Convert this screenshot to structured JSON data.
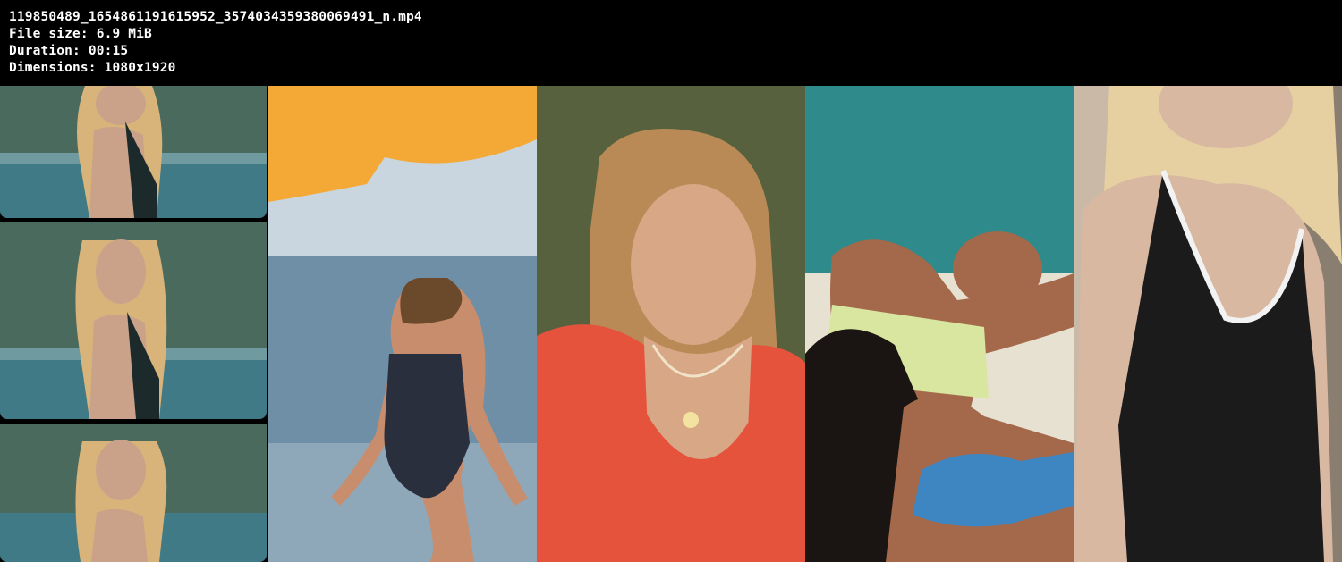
{
  "video_info": {
    "filename": "119850489_1654861191615952_3574034359380069491_n.mp4",
    "file_size_label": "File size:",
    "file_size": "6.9 MiB",
    "duration_label": "Duration:",
    "duration": "00:15",
    "dimensions_label": "Dimensions:",
    "dimensions": "1080x1920"
  },
  "thumbnails": [
    {
      "icon": "triple-film-frame-woman-by-sea-image",
      "colors": {
        "sea": "#3f7a86",
        "rock": "#4b6a5e",
        "hair": "#d8b47a",
        "skin": "#caa28a",
        "suit": "#1d2a2c"
      }
    },
    {
      "icon": "woman-in-gingham-swimsuit-beach-image",
      "colors": {
        "sky": "#c9d6e0",
        "sea": "#6f8fa6",
        "umbrella": "#f4a936",
        "suit": "#2a2f3e",
        "skin": "#c88d6c"
      }
    },
    {
      "icon": "woman-smiling-red-floral-dress-image",
      "colors": {
        "foliage": "#2e4a26",
        "dress": "#e5533d",
        "skin": "#d7a786",
        "hair": "#b98a55"
      }
    },
    {
      "icon": "two-women-laughing-on-blanket-image",
      "colors": {
        "sea": "#2f8a8c",
        "top": "#d8e6a0",
        "bikini": "#3d86c2",
        "skin": "#a4684a",
        "hair": "#1a1412"
      }
    },
    {
      "icon": "blonde-woman-black-swimsuit-image",
      "colors": {
        "bg": "#cbb9a8",
        "suit": "#1b1b1b",
        "trim": "#f2f2f2",
        "skin": "#d9b8a2",
        "hair": "#e6cfa0"
      }
    }
  ]
}
